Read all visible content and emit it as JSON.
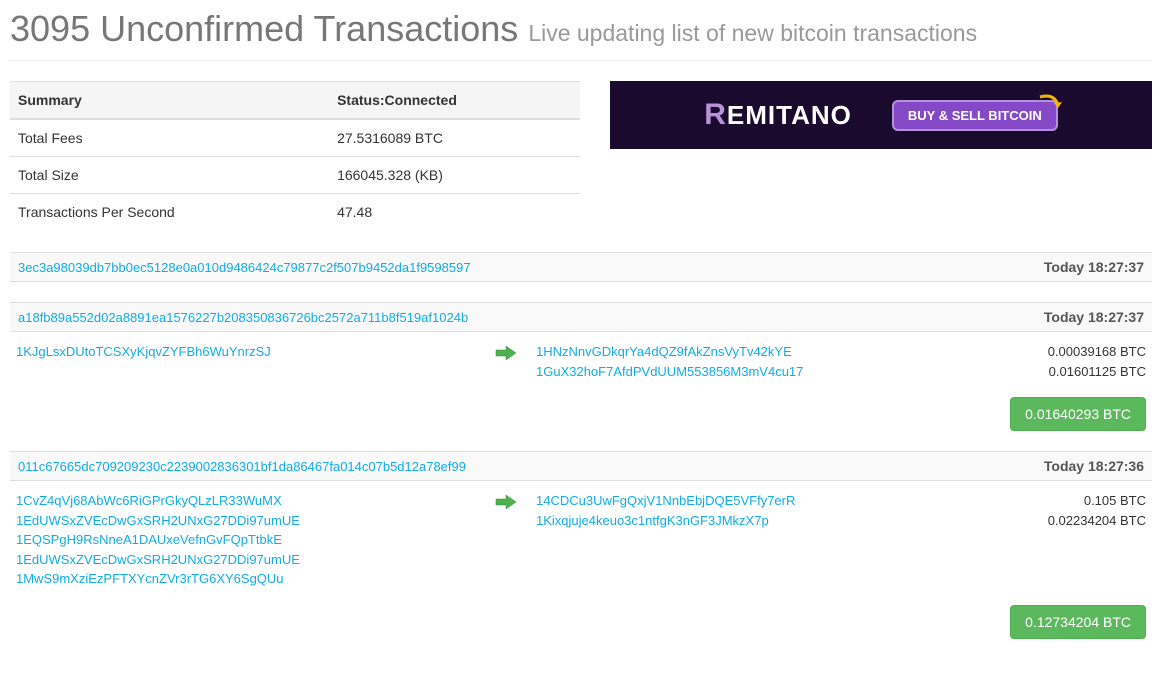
{
  "header": {
    "count": "3095",
    "title_rest": "Unconfirmed Transactions",
    "subtitle": "Live updating list of new bitcoin transactions"
  },
  "summary": {
    "label_header": "Summary",
    "status_header": "Status:Connected",
    "rows": [
      {
        "label": "Total Fees",
        "value": "27.5316089 BTC"
      },
      {
        "label": "Total Size",
        "value": "166045.328 (KB)"
      },
      {
        "label": "Transactions Per Second",
        "value": "47.48"
      }
    ]
  },
  "ad": {
    "logo_r": "R",
    "logo_rest": "EMITANO",
    "button_label": "BUY & SELL BITCOIN"
  },
  "partial_hash_top": "",
  "txs": [
    {
      "hash": "3ec3a98039db7bb0ec5128e0a010d9486424c79877c2f507b9452da1f9598597",
      "time": "Today 18:27:37",
      "inputs": [],
      "outputs": [],
      "total": null
    },
    {
      "hash": "a18fb89a552d02a8891ea1576227b208350836726bc2572a711b8f519af1024b",
      "time": "Today 18:27:37",
      "inputs": [
        "1KJgLsxDUtoTCSXyKjqvZYFBh6WuYnrzSJ"
      ],
      "outputs": [
        {
          "addr": "1HNzNnvGDkqrYa4dQZ9fAkZnsVyTv42kYE",
          "amount": "0.00039168 BTC"
        },
        {
          "addr": "1GuX32hoF7AfdPVdUUM553856M3mV4cu17",
          "amount": "0.01601125 BTC"
        }
      ],
      "total": "0.01640293 BTC"
    },
    {
      "hash": "011c67665dc709209230c2239002836301bf1da86467fa014c07b5d12a78ef99",
      "time": "Today 18:27:36",
      "inputs": [
        "1CvZ4qVj68AbWc6RiGPrGkyQLzLR33WuMX",
        "1EdUWSxZVEcDwGxSRH2UNxG27DDi97umUE",
        "1EQSPgH9RsNneA1DAUxeVefnGvFQpTtbkE",
        "1EdUWSxZVEcDwGxSRH2UNxG27DDi97umUE",
        "1MwS9mXziEzPFTXYcnZVr3rTG6XY6SgQUu"
      ],
      "outputs": [
        {
          "addr": "14CDCu3UwFgQxjV1NnbEbjDQE5VFfy7erR",
          "amount": "0.105 BTC"
        },
        {
          "addr": "1Kixqjuje4keuo3c1ntfgK3nGF3JMkzX7p",
          "amount": "0.02234204 BTC"
        }
      ],
      "total": "0.12734204 BTC"
    }
  ]
}
